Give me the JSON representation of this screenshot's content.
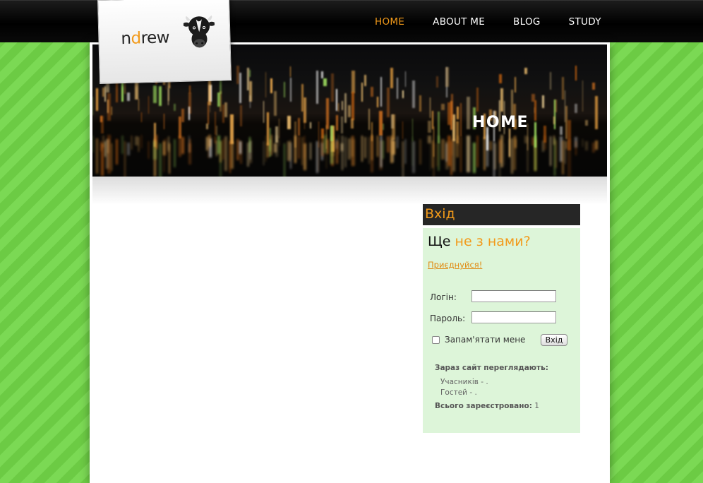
{
  "logo": {
    "prefix": "n",
    "accent": "d",
    "suffix": "rew"
  },
  "nav": {
    "items": [
      {
        "label": "HOME"
      },
      {
        "label": "ABOUT ME"
      },
      {
        "label": "BLOG"
      },
      {
        "label": "STUDY"
      }
    ]
  },
  "banner": {
    "title": "HOME"
  },
  "login": {
    "heading": "Вхід",
    "question_plain": "Ще",
    "question_highlight": "не з нами?",
    "join_link": "Приєднуйся!",
    "username_label": "Логін:",
    "username_value": "",
    "password_label": "Пароль:",
    "password_value": "",
    "remember_label": "Запам'ятати мене",
    "submit_label": "Вхід",
    "online_title": "Зараз сайт переглядають:",
    "members_line": "Учасників - .",
    "guests_line": "Гостей - .",
    "registered_label": "Всього зареєстровано:",
    "registered_count": "1"
  },
  "colors": {
    "accent": "#f29a1a",
    "background_green": "#74d34c",
    "sidebar_bg": "#ddf5d9",
    "header_bg": "#262626"
  }
}
